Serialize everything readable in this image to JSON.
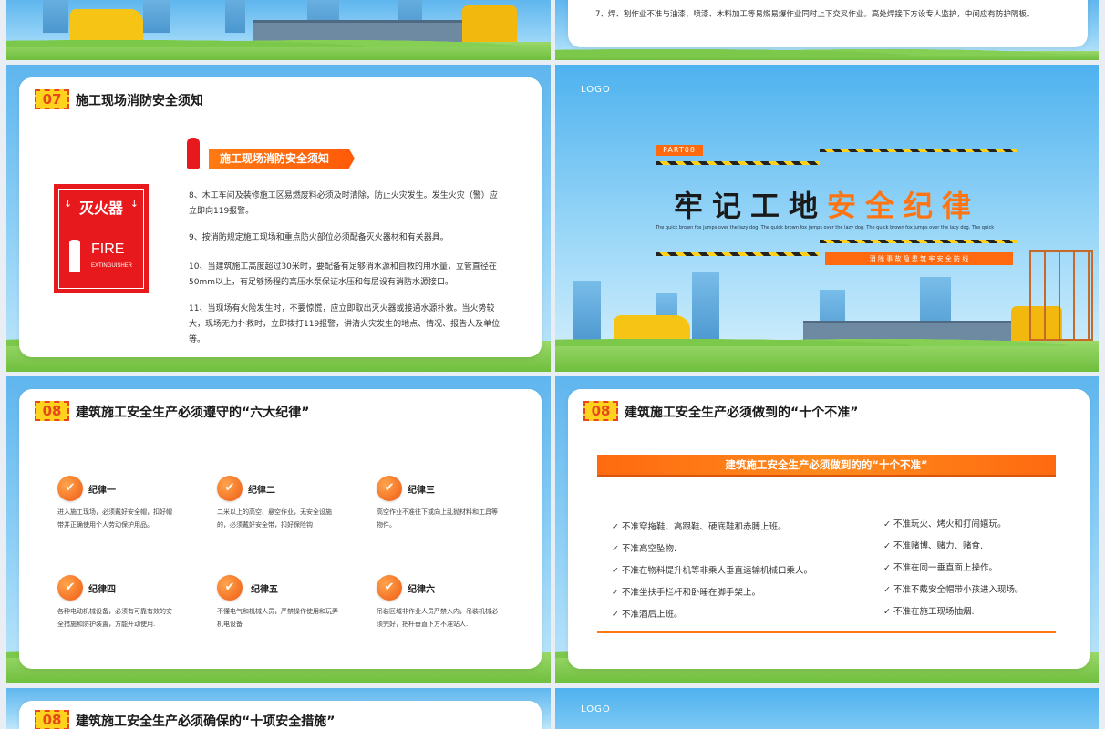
{
  "slide_top_right": {
    "text": "7、焊、割作业不准与油漆、喷漆、木料加工等易燃易爆作业同时上下交叉作业。高处焊接下方设专人监护，中间应有防护隔板。"
  },
  "slide_07": {
    "badge": "07",
    "title": "施工现场消防安全须知",
    "ribbon": "施工现场消防安全须知",
    "sign_cn": "灭火器",
    "sign_en": "FIRE",
    "sign_en_small": "EXTINGUISHER",
    "items": [
      "8、木工车间及装修施工区易燃废料必须及时清除，防止火灾发生。发生火灾（警）应立即向119报警。",
      "9、按消防规定施工现场和重点防火部位必须配备灭火器材和有关器具。",
      "10、当建筑施工高度超过30米时，要配备有足够消水源和自救的用水量，立管直径在50mm以上，有足够扬程的高压水泵保证水压和每层设有消防水源接口。",
      "11、当现场有火险发生时，不要惊慌，应立即取出灭火器或接通水源扑救。当火势较大，现场无力扑救时，立即拨打119报警，讲清火灾发生的地点、情况、报告人及单位等。"
    ]
  },
  "slide_part08": {
    "logo": "LOGO",
    "part": "PART08",
    "title_black": "牢记工地",
    "title_orange": "安全纪律",
    "subtitle": "The quick brown fox jumps over the lazy dog. The quick brown fox jumps over the lazy dog. The quick brown fox jumps over the lazy dog. The quick",
    "slogan": "消 除 事 故 隐 患 筑 牢 安 全 防 线"
  },
  "slide_08a": {
    "badge": "08",
    "title": "建筑施工安全生产必须遵守的“六大纪律”",
    "rules": [
      {
        "title": "纪律一",
        "desc": "进入施工现场，必须戴好安全帽，扣好帽带并正确使用个人劳动保护用品。"
      },
      {
        "title": "纪律二",
        "desc": "二米以上的高空、悬空作业，无安全设施的，必须戴好安全带，扣好保险钩"
      },
      {
        "title": "纪律三",
        "desc": "高空作业不准往下或向上乱抛材料和工具等物件。"
      },
      {
        "title": "纪律四",
        "desc": "各种电动机械设备，必须有可靠有效的安全措施和防护装置，方能开动使用."
      },
      {
        "title": "纪律五",
        "desc": "不懂电气和机械人员，严禁操作使用和玩弄机电设备"
      },
      {
        "title": "纪律六",
        "desc": "吊装区域非作业人员严禁入内，吊装机械必须完好，把杆垂直下方不准站人."
      }
    ]
  },
  "slide_08b": {
    "badge": "08",
    "title": "建筑施工安全生产必须做到的“十个不准”",
    "banner": "建筑施工安全生产必须做到的的“十个不准”",
    "left_items": [
      "不准穿拖鞋、高跟鞋、硬底鞋和赤膊上班。",
      "不准高空坠物.",
      "不准在物料提升机等非乘人垂直运输机械口乘人。",
      "不准坐扶手栏杆和卧睡在脚手架上。",
      "不准酒后上班。"
    ],
    "right_items": [
      "不准玩火、烤火和打闹嬉玩。",
      "不准赌博、赌力、赌食.",
      "不准在同一垂直面上操作。",
      "不准不戴安全帽带小孩进入现场。",
      "不准在施工现场抽烟."
    ]
  },
  "slide_08c": {
    "badge": "08",
    "title": "建筑施工安全生产必须确保的“十项安全措施”"
  },
  "slide_bottom_right": {
    "logo": "LOGO"
  },
  "colors": {
    "accent_orange": "#ff6a10",
    "badge_yellow": "#ffd21e",
    "badge_red": "#e8471c",
    "sky_blue": "#6cc0f0"
  }
}
